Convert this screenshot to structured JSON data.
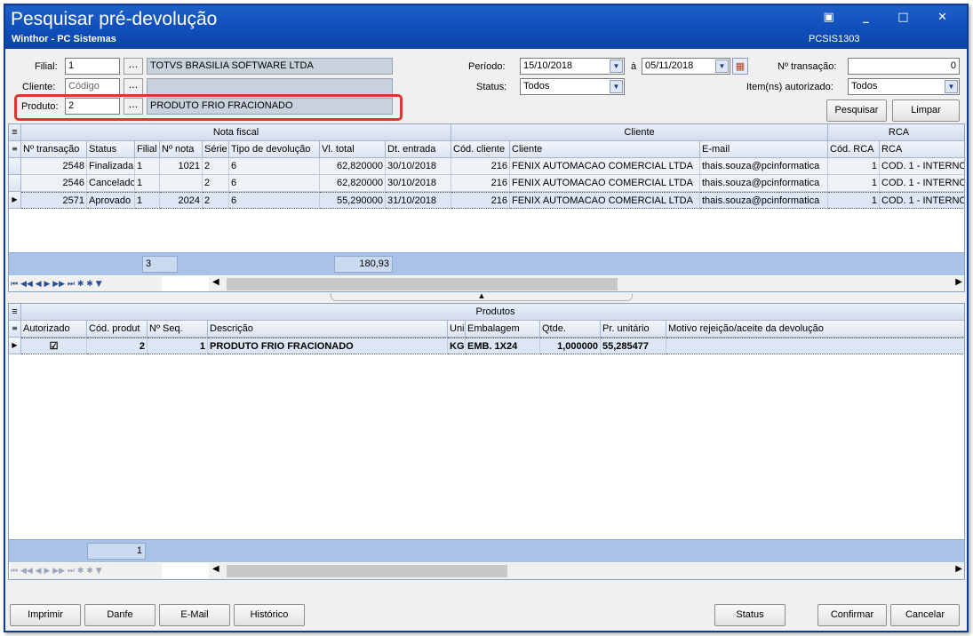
{
  "window": {
    "title": "Pesquisar pré-devolução",
    "subtitle": "Winthor - PC Sistemas",
    "code": "PCSIS1303",
    "controls": "▣ _ □ ✕"
  },
  "filters": {
    "filial_label": "Filial:",
    "filial_value": "1",
    "filial_desc": "TOTVS BRASILIA SOFTWARE LTDA",
    "cliente_label": "Cliente:",
    "cliente_placeholder": "Código",
    "produto_label": "Produto:",
    "produto_value": "2",
    "produto_desc": "PRODUTO FRIO FRACIONADO",
    "periodo_label": "Período:",
    "periodo_start": "15/10/2018",
    "periodo_sep": "à",
    "periodo_end": "05/11/2018",
    "status_label": "Status:",
    "status_value": "Todos",
    "transacao_label": "Nº transação:",
    "transacao_value": "0",
    "itens_label": "Item(ns) autorizado:",
    "itens_value": "Todos",
    "pesquisar": "Pesquisar",
    "limpar": "Limpar",
    "dots": "..."
  },
  "grid1": {
    "bands": [
      "Nota fiscal",
      "Cliente",
      "RCA"
    ],
    "columns": [
      "Nº transação",
      "Status",
      "Filial",
      "Nº nota",
      "Série",
      "Tipo de devolução",
      "Vl. total",
      "Dt. entrada",
      "Cód. cliente",
      "Cliente",
      "E-mail",
      "Cód. RCA",
      "RCA"
    ],
    "rows": [
      [
        "2548",
        "Finalizada",
        "1",
        "1021",
        "2",
        "6",
        "62,820000",
        "30/10/2018",
        "216",
        "FENIX AUTOMACAO COMERCIAL LTDA",
        "thais.souza@pcinformatica",
        "1",
        "COD. 1 - INTERNO"
      ],
      [
        "2546",
        "Cancelado",
        "1",
        "",
        "2",
        "6",
        "62,820000",
        "30/10/2018",
        "216",
        "FENIX AUTOMACAO COMERCIAL LTDA",
        "thais.souza@pcinformatica",
        "1",
        "COD. 1 - INTERNO"
      ],
      [
        "2571",
        "Aprovado",
        "1",
        "2024",
        "2",
        "6",
        "55,290000",
        "31/10/2018",
        "216",
        "FENIX AUTOMACAO COMERCIAL LTDA",
        "thais.souza@pcinformatica",
        "1",
        "COD. 1 - INTERNO"
      ]
    ],
    "footer_count": "3",
    "footer_total": "180,93"
  },
  "grid2": {
    "band": "Produtos",
    "columns": [
      "Autorizado",
      "Cód. produt",
      "Nº Seq.",
      "Descrição",
      "Uni",
      "Embalagem",
      "Qtde.",
      "Pr. unitário",
      "Motivo rejeição/aceite da devolução"
    ],
    "rows": [
      [
        "☑",
        "2",
        "1",
        "PRODUTO FRIO FRACIONADO",
        "KG",
        "EMB. 1X24",
        "1,000000",
        "55,285477",
        ""
      ]
    ],
    "footer_count": "1"
  },
  "buttons": {
    "imprimir": "Imprimir",
    "danfe": "Danfe",
    "email": "E-Mail",
    "historico": "Histórico",
    "status": "Status",
    "confirmar": "Confirmar",
    "cancelar": "Cancelar"
  },
  "navigator": "⏮ ◀◀ ◀ ▶ ▶▶ ⏭ ✱ ✱ ▼"
}
